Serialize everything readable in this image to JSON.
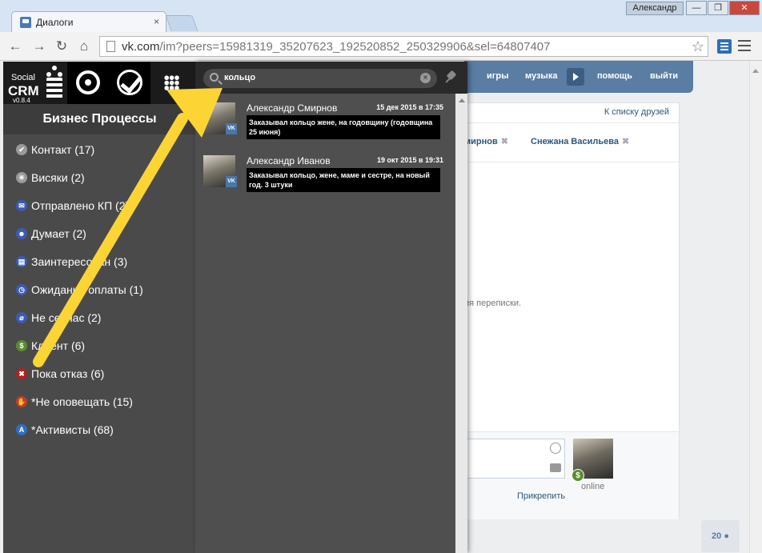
{
  "browser": {
    "tab_title": "Диалоги",
    "tab_close": "×",
    "user": "Александр",
    "win_min": "—",
    "win_max": "❐",
    "win_close": "✕",
    "back": "←",
    "forward": "→",
    "reload": "↻",
    "home": "⌂",
    "url_host": "vk.com",
    "url_path": "/im?peers=15981319_35207623_192520852_250329906&sel=64807407",
    "star": "☆"
  },
  "vk": {
    "nav": [
      "игры",
      "музыка",
      "помощь",
      "выйти"
    ],
    "friends_link": "К списку друзей",
    "peers": [
      "мирнов",
      "Снежана Васильева"
    ],
    "peer_close": "✖",
    "hint": "ия переписки.",
    "online": "online",
    "attach": "Прикрепить",
    "counter": "20"
  },
  "crm": {
    "logo": {
      "social": "Social",
      "crm": "CRM",
      "version": "v0.8.4"
    },
    "section_title": "Бизнес Процессы",
    "stages": [
      {
        "label": "Контакт (17)",
        "icon": "check-circle-icon",
        "glyph": "✔",
        "color": "#9a9a9a"
      },
      {
        "label": "Висяки (2)",
        "icon": "snowflake-icon",
        "glyph": "✳",
        "color": "#9a9a9a"
      },
      {
        "label": "Отправлено КП (2)",
        "icon": "envelope-icon",
        "glyph": "✉",
        "color": "#3b5bb5"
      },
      {
        "label": "Думает (2)",
        "icon": "thinking-person-icon",
        "glyph": "☻",
        "color": "#3b5bb5"
      },
      {
        "label": "Заинтересован (3)",
        "icon": "briefcase-icon",
        "glyph": "▤",
        "color": "#3b5bb5"
      },
      {
        "label": "Ожидание оплаты (1)",
        "icon": "clock-icon",
        "glyph": "◷",
        "color": "#3b5bb5"
      },
      {
        "label": "Не сейчас (2)",
        "icon": "no-phone-icon",
        "glyph": "⌀",
        "color": "#3b5bb5"
      },
      {
        "label": "Клиент (6)",
        "icon": "dollar-icon",
        "glyph": "$",
        "color": "#5a8d2e"
      },
      {
        "label": "Пока отказ (6)",
        "icon": "cross-circle-icon",
        "glyph": "✖",
        "color": "#b51f1f"
      },
      {
        "label": "*Не оповещать (15)",
        "icon": "stop-hand-icon",
        "glyph": "✋",
        "color": "#c43b2b"
      },
      {
        "label": "*Активисты (68)",
        "icon": "letter-a-icon",
        "glyph": "A",
        "color": "#2f6ec4"
      }
    ]
  },
  "search": {
    "query": "кольцо",
    "clear": "×",
    "results": [
      {
        "name": "Александр Смирнов",
        "date": "15 дек 2015 в 17:35",
        "text": "Заказывал кольцо жене, на годовщину (годовщина 25 июня)",
        "badge": "vk"
      },
      {
        "name": "Александр Иванов",
        "date": "19 окт 2015 в 19:31",
        "text": "Заказывал кольцо, жене, маме и сестре, на новый год. 3 штуки",
        "badge": "vk"
      }
    ]
  },
  "colors": {
    "arrow": "#fcd535",
    "vk_blue": "#597da3",
    "crm_bg": "#4a4a4a"
  }
}
